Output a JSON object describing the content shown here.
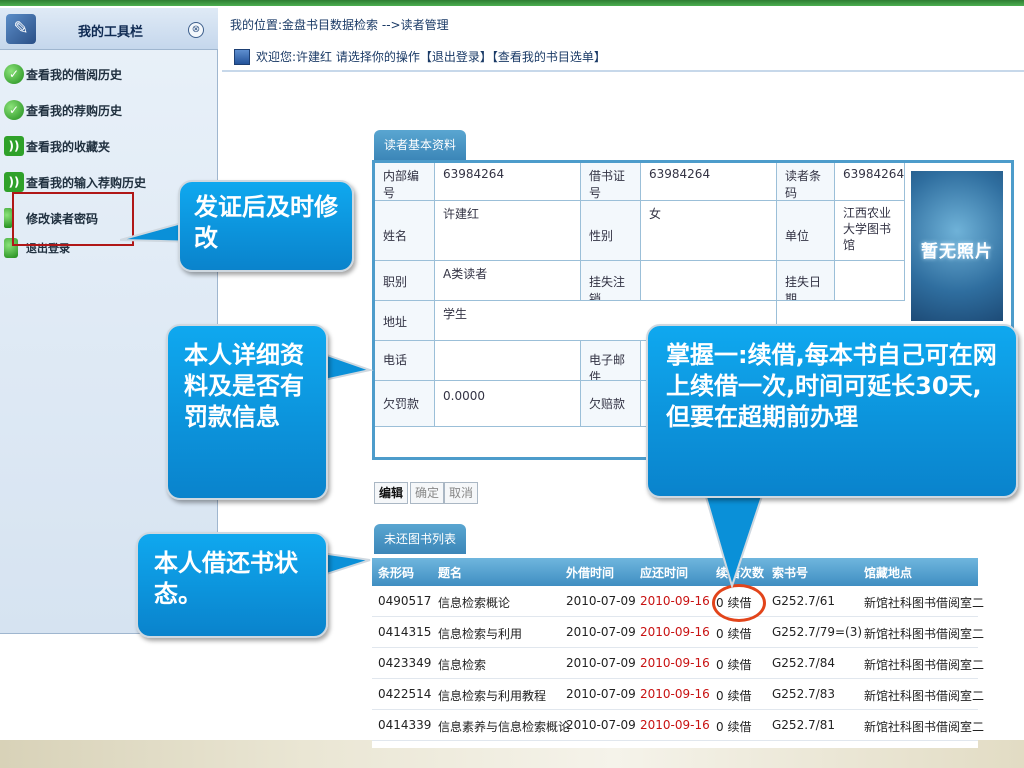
{
  "sidebar": {
    "title": "我的工具栏",
    "toggle": "⊗",
    "items": [
      {
        "label": "查看我的借阅历史"
      },
      {
        "label": "查看我的荐购历史"
      },
      {
        "label": "查看我的收藏夹"
      },
      {
        "label": "查看我的输入荐购历史"
      },
      {
        "label": "修改读者密码"
      },
      {
        "label": "退出登录"
      }
    ]
  },
  "header": {
    "breadcrumb": "我的位置:金盘书目数据检索 -->读者管理",
    "welcome": "欢迎您:许建红 请选择你的操作【退出登录】【查看我的书目选单】"
  },
  "info": {
    "tab": "读者基本资料",
    "labels": {
      "internal_no": "内部编号",
      "card_no": "借书证号",
      "barcode": "读者条码",
      "name": "姓名",
      "gender": "性别",
      "unit": "单位",
      "rank": "职别",
      "loss_cancel": "挂失注销",
      "loss_date": "挂失日期",
      "address": "地址",
      "phone": "电话",
      "email": "电子邮件",
      "fine": "欠罚款",
      "compensation": "欠赔款"
    },
    "values": {
      "internal_no": "63984264",
      "card_no": "63984264",
      "barcode": "63984264",
      "name": "许建红",
      "gender": "女",
      "unit": "江西农业大学图书馆",
      "rank": "A类读者",
      "address": "学生",
      "fine": "0.0000"
    },
    "photo_text": "暂无照片"
  },
  "buttons": {
    "edit": "编辑",
    "confirm": "确定",
    "cancel": "取消"
  },
  "loans": {
    "tab": "未还图书列表",
    "headers": [
      "条形码",
      "题名",
      "外借时间",
      "应还时间",
      "续借次数",
      "索书号",
      "馆藏地点"
    ],
    "rows": [
      {
        "barcode": "0490517",
        "title": "信息检索概论",
        "out": "2010-07-09",
        "due": "2010-09-16",
        "renew": "0 续借",
        "callno": "G252.7/61",
        "location": "新馆社科图书借阅室二"
      },
      {
        "barcode": "0414315",
        "title": "信息检索与利用",
        "out": "2010-07-09",
        "due": "2010-09-16",
        "renew": "0 续借",
        "callno": "G252.7/79=(3)",
        "location": "新馆社科图书借阅室二"
      },
      {
        "barcode": "0423349",
        "title": "信息检索",
        "out": "2010-07-09",
        "due": "2010-09-16",
        "renew": "0 续借",
        "callno": "G252.7/84",
        "location": "新馆社科图书借阅室二"
      },
      {
        "barcode": "0422514",
        "title": "信息检索与利用教程",
        "out": "2010-07-09",
        "due": "2010-09-16",
        "renew": "0 续借",
        "callno": "G252.7/83",
        "location": "新馆社科图书借阅室二"
      },
      {
        "barcode": "0414339",
        "title": "信息素养与信息检索概论",
        "out": "2010-07-09",
        "due": "2010-09-16",
        "renew": "0 续借",
        "callno": "G252.7/81",
        "location": "新馆社科图书借阅室二"
      }
    ]
  },
  "callouts": {
    "password": "发证后及时修改",
    "details": "本人详细资料及是否有罚款信息",
    "loans": "本人借还书状态。",
    "renew": "掌握一:续借,每本书自己可在网上续借一次,时间可延长30天,但要在超期前办理"
  },
  "colors": {
    "accent": "#0a94dd",
    "due": "#c81212",
    "highlight": "#e2441a"
  }
}
